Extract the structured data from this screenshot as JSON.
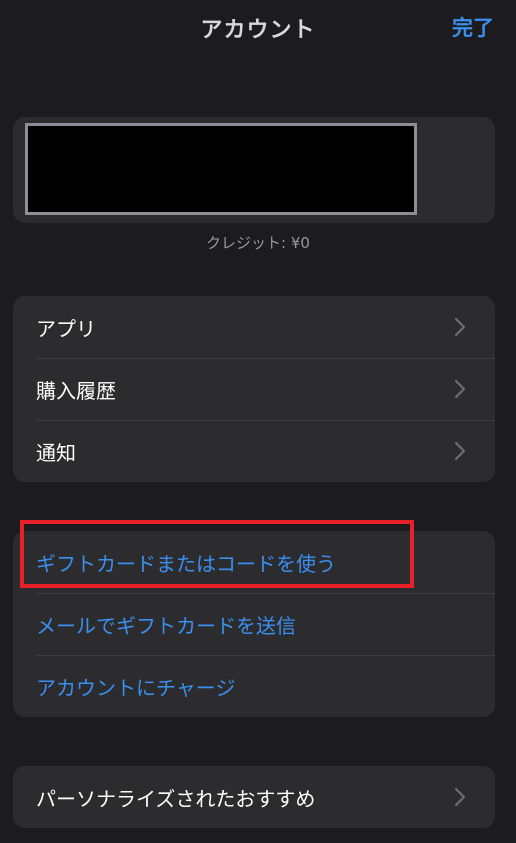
{
  "nav": {
    "title": "アカウント",
    "done_label": "完了"
  },
  "profile": {
    "credit": "クレジット: ¥0"
  },
  "menu": {
    "items": [
      {
        "label": "アプリ"
      },
      {
        "label": "購入履歴"
      },
      {
        "label": "通知"
      }
    ]
  },
  "gift": {
    "items": [
      {
        "label": "ギフトカードまたはコードを使う"
      },
      {
        "label": "メールでギフトカードを送信"
      },
      {
        "label": "アカウントにチャージ"
      }
    ]
  },
  "personal": {
    "label": "パーソナライズされたおすすめ"
  },
  "colors": {
    "background": "#1c1c1e",
    "card": "#2c2c2e",
    "accent": "#3a8ff0",
    "highlight": "#e8202a"
  },
  "icons": {
    "row_chevron": "chevron-right-icon"
  }
}
